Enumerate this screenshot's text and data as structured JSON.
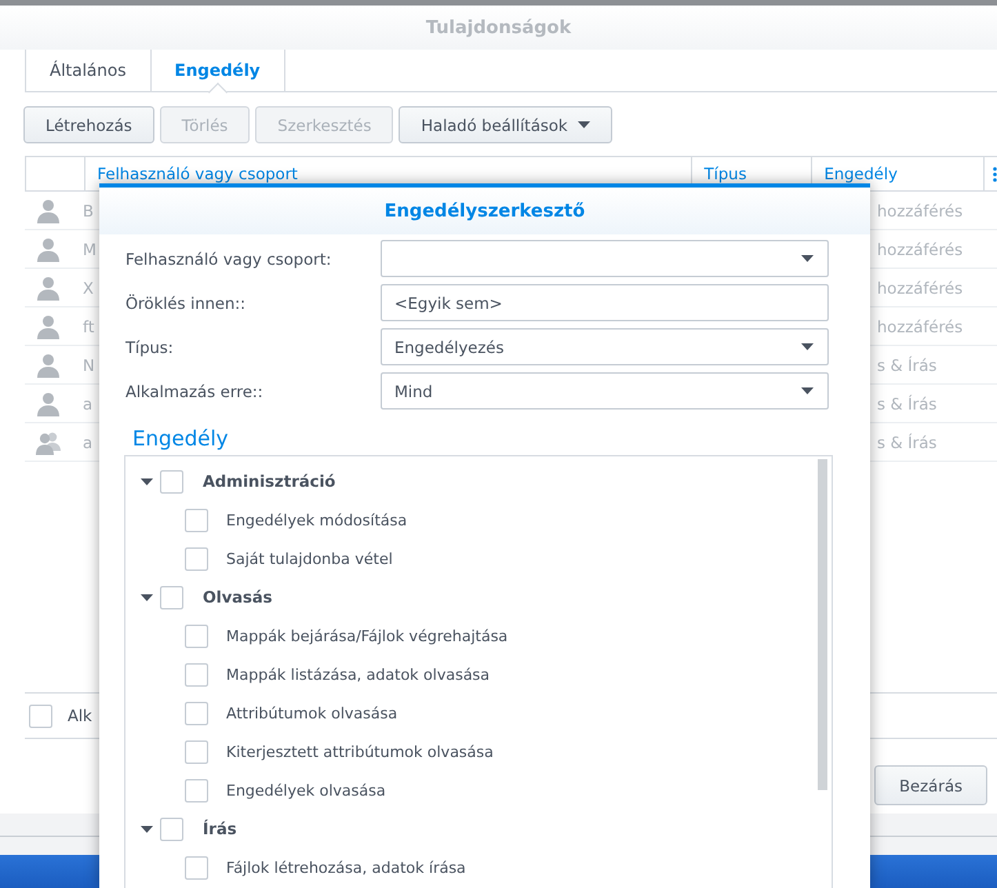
{
  "window": {
    "title": "Tulajdonságok"
  },
  "tabs": [
    {
      "label": "Általános",
      "selected": false
    },
    {
      "label": "Engedély",
      "selected": true
    }
  ],
  "toolbar": [
    {
      "label": "Létrehozás",
      "disabled": false,
      "kind": "button"
    },
    {
      "label": "Törlés",
      "disabled": true,
      "kind": "button"
    },
    {
      "label": "Szerkesztés",
      "disabled": true,
      "kind": "button"
    },
    {
      "label": "Haladó beállítások",
      "disabled": false,
      "kind": "dropdown"
    }
  ],
  "table": {
    "columns": [
      "Felhasználó vagy csoport",
      "Típus",
      "Engedély"
    ],
    "rows": [
      {
        "kind": "user",
        "name": "B",
        "permission": "hozzáférés"
      },
      {
        "kind": "user",
        "name": "M",
        "permission": "hozzáférés"
      },
      {
        "kind": "user",
        "name": "X",
        "permission": "hozzáférés"
      },
      {
        "kind": "user",
        "name": "ft",
        "permission": "hozzáférés"
      },
      {
        "kind": "user",
        "name": "N",
        "permission": "s & Írás"
      },
      {
        "kind": "user",
        "name": "a",
        "permission": "s & Írás"
      },
      {
        "kind": "group",
        "name": "a",
        "permission": "s & Írás"
      }
    ]
  },
  "footer": {
    "checkbox": {
      "label": "Alk",
      "checked": false
    },
    "close_button": "Bezárás"
  },
  "dialog": {
    "title": "Engedélyszerkesztő",
    "fields": [
      {
        "label": "Felhasználó vagy csoport:",
        "kind": "dropdown"
      },
      {
        "label": "Öröklés innen::",
        "kind": "text",
        "value": "<Egyik sem>"
      },
      {
        "label": "Típus:",
        "kind": "dropdown",
        "value": "Engedélyezés"
      },
      {
        "label": "Alkalmazás erre::",
        "kind": "dropdown",
        "value": "Mind"
      }
    ],
    "section_title": "Engedély",
    "permissions": [
      {
        "label": "Adminisztráció",
        "checked": false,
        "expanded": true,
        "children": [
          {
            "label": "Engedélyek módosítása",
            "checked": false
          },
          {
            "label": "Saját tulajdonba vétel",
            "checked": false
          }
        ]
      },
      {
        "label": "Olvasás",
        "checked": false,
        "expanded": true,
        "children": [
          {
            "label": "Mappák bejárása/Fájlok végrehajtása",
            "checked": false
          },
          {
            "label": "Mappák listázása, adatok olvasása",
            "checked": false
          },
          {
            "label": "Attribútumok olvasása",
            "checked": false
          },
          {
            "label": "Kiterjesztett attribútumok olvasása",
            "checked": false
          },
          {
            "label": "Engedélyek olvasása",
            "checked": false
          }
        ]
      },
      {
        "label": "Írás",
        "checked": false,
        "expanded": true,
        "children": [
          {
            "label": "Fájlok létrehozása, adatok írása",
            "checked": false
          }
        ]
      }
    ]
  }
}
